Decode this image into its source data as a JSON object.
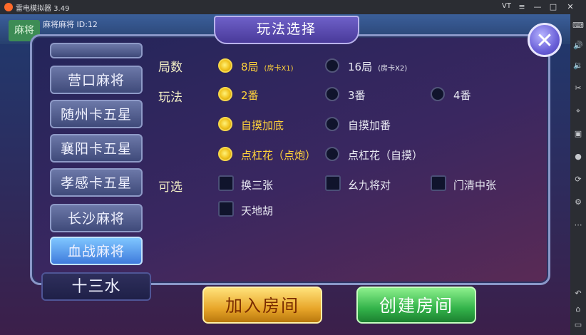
{
  "emulator": {
    "title": "雷电模拟器 3.49",
    "vt_label": "VT",
    "window_buttons": [
      "≡",
      "—",
      "□",
      "✕"
    ],
    "toolbar_icons": [
      "keyboard-icon",
      "volume-up-icon",
      "volume-down-icon",
      "scissors-icon",
      "location-icon",
      "screenshot-icon",
      "record-icon",
      "sync-icon",
      "settings-icon",
      "more-icon",
      "back-icon",
      "home-icon",
      "recent-icon"
    ]
  },
  "game": {
    "top_badge": "麻将",
    "top_info": "麻将麻将 ID:12"
  },
  "dialog": {
    "title": "玩法选择",
    "close": "✕",
    "games": [
      {
        "label": "",
        "selected": false
      },
      {
        "label": "营口麻将",
        "selected": false
      },
      {
        "label": "随州卡五星",
        "selected": false
      },
      {
        "label": "襄阳卡五星",
        "selected": false
      },
      {
        "label": "孝感卡五星",
        "selected": false
      },
      {
        "label": "长沙麻将",
        "selected": false
      },
      {
        "label": "血战麻将",
        "selected": true
      },
      {
        "label": "十三水",
        "selected": false
      }
    ],
    "rows": {
      "rounds_label": "局数",
      "rounds_options": [
        {
          "label": "8局",
          "note": "(房卡X1)",
          "on": true
        },
        {
          "label": "16局",
          "note": "(房卡X2)",
          "on": false
        }
      ],
      "play_label": "玩法",
      "play_options": [
        {
          "label": "2番",
          "on": true
        },
        {
          "label": "3番",
          "on": false
        },
        {
          "label": "4番",
          "on": false
        }
      ],
      "zimo_options": [
        {
          "label": "自摸加底",
          "on": true
        },
        {
          "label": "自摸加番",
          "on": false
        }
      ],
      "gang_options": [
        {
          "label": "点杠花（点炮）",
          "on": true
        },
        {
          "label": "点杠花（自摸）",
          "on": false
        }
      ],
      "optional_label": "可选",
      "optional_checks": [
        {
          "label": "换三张"
        },
        {
          "label": "幺九将对"
        },
        {
          "label": "门清中张"
        },
        {
          "label": "天地胡"
        }
      ]
    },
    "buttons": {
      "join": "加入房间",
      "create": "创建房间"
    }
  }
}
